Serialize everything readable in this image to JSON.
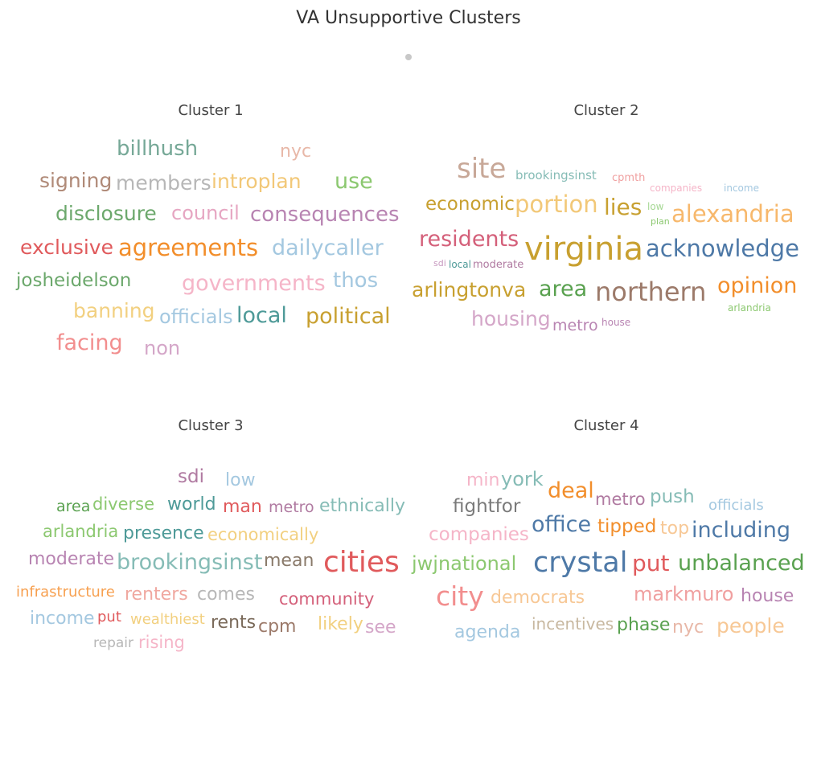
{
  "title": "VA Unsupportive Clusters",
  "chart_data": [
    {
      "type": "wordcloud",
      "title": "Cluster 1",
      "words": [
        {
          "text": "billhush",
          "size": 26,
          "color": "#76a897"
        },
        {
          "text": "nyc",
          "size": 22,
          "color": "#e8b8a8"
        },
        {
          "text": "signing",
          "size": 25,
          "color": "#b08a78"
        },
        {
          "text": "members",
          "size": 25,
          "color": "#b7b7b7"
        },
        {
          "text": "introplan",
          "size": 25,
          "color": "#f2c878"
        },
        {
          "text": "use",
          "size": 27,
          "color": "#8cc870"
        },
        {
          "text": "disclosure",
          "size": 25,
          "color": "#6ca86c"
        },
        {
          "text": "council",
          "size": 24,
          "color": "#e6a6c2"
        },
        {
          "text": "consequences",
          "size": 26,
          "color": "#b884b2"
        },
        {
          "text": "exclusive",
          "size": 25,
          "color": "#e05a5c"
        },
        {
          "text": "agreements",
          "size": 29,
          "color": "#f28e2b"
        },
        {
          "text": "dailycaller",
          "size": 27,
          "color": "#a4c8e0"
        },
        {
          "text": "josheidelson",
          "size": 23,
          "color": "#6ca86c"
        },
        {
          "text": "governments",
          "size": 27,
          "color": "#f5b5c8"
        },
        {
          "text": "thos",
          "size": 26,
          "color": "#a4c8e0"
        },
        {
          "text": "banning",
          "size": 25,
          "color": "#f2d080"
        },
        {
          "text": "officials",
          "size": 24,
          "color": "#a4c8e0"
        },
        {
          "text": "local",
          "size": 27,
          "color": "#4e9a98"
        },
        {
          "text": "political",
          "size": 27,
          "color": "#c8a030"
        },
        {
          "text": "facing",
          "size": 27,
          "color": "#f28e8e"
        },
        {
          "text": "non",
          "size": 24,
          "color": "#d4a6c8"
        }
      ]
    },
    {
      "type": "wordcloud",
      "title": "Cluster 2",
      "words": [
        {
          "text": "site",
          "size": 34,
          "color": "#c8a898"
        },
        {
          "text": "brookingsinst",
          "size": 15,
          "color": "#86bcb6"
        },
        {
          "text": "cpmth",
          "size": 13,
          "color": "#f0a0a0"
        },
        {
          "text": "companies",
          "size": 12,
          "color": "#f5b5c8"
        },
        {
          "text": "income",
          "size": 12,
          "color": "#a4c8e0"
        },
        {
          "text": "economic",
          "size": 23,
          "color": "#c8a030"
        },
        {
          "text": "portion",
          "size": 29,
          "color": "#f2c878"
        },
        {
          "text": "lies",
          "size": 28,
          "color": "#c8a030"
        },
        {
          "text": "low",
          "size": 12,
          "color": "#a6d894"
        },
        {
          "text": "plan",
          "size": 11,
          "color": "#8cc870"
        },
        {
          "text": "alexandria",
          "size": 29,
          "color": "#f7b86c"
        },
        {
          "text": "residents",
          "size": 27,
          "color": "#d4607a"
        },
        {
          "text": "virginia",
          "size": 40,
          "color": "#c8a030"
        },
        {
          "text": "acknowledge",
          "size": 29,
          "color": "#4e79a7"
        },
        {
          "text": "sdi",
          "size": 11,
          "color": "#c89ac0"
        },
        {
          "text": "local",
          "size": 12,
          "color": "#4e9a98"
        },
        {
          "text": "moderate",
          "size": 13,
          "color": "#b07aa1"
        },
        {
          "text": "arlingtonva",
          "size": 25,
          "color": "#c8a030"
        },
        {
          "text": "area",
          "size": 27,
          "color": "#59a14f"
        },
        {
          "text": "northern",
          "size": 32,
          "color": "#9c7a6a"
        },
        {
          "text": "opinion",
          "size": 27,
          "color": "#f28e2b"
        },
        {
          "text": "arlandria",
          "size": 12,
          "color": "#8cc870"
        },
        {
          "text": "housing",
          "size": 25,
          "color": "#d4a6c8"
        },
        {
          "text": "metro",
          "size": 19,
          "color": "#b884b2"
        },
        {
          "text": "house",
          "size": 12,
          "color": "#b884b2"
        }
      ]
    },
    {
      "type": "wordcloud",
      "title": "Cluster 3",
      "words": [
        {
          "text": "sdi",
          "size": 23,
          "color": "#b07aa1"
        },
        {
          "text": "low",
          "size": 22,
          "color": "#a4c8e0"
        },
        {
          "text": "area",
          "size": 19,
          "color": "#59a14f"
        },
        {
          "text": "diverse",
          "size": 21,
          "color": "#8cc870"
        },
        {
          "text": "world",
          "size": 22,
          "color": "#4e9a98"
        },
        {
          "text": "man",
          "size": 22,
          "color": "#e05a5c"
        },
        {
          "text": "metro",
          "size": 19,
          "color": "#b07aa1"
        },
        {
          "text": "ethnically",
          "size": 22,
          "color": "#86bcb6"
        },
        {
          "text": "arlandria",
          "size": 21,
          "color": "#8cc870"
        },
        {
          "text": "presence",
          "size": 22,
          "color": "#4e9a98"
        },
        {
          "text": "economically",
          "size": 21,
          "color": "#f2d080"
        },
        {
          "text": "moderate",
          "size": 22,
          "color": "#b884b2"
        },
        {
          "text": "brookingsinst",
          "size": 27,
          "color": "#86bcb6"
        },
        {
          "text": "mean",
          "size": 22,
          "color": "#8a7a6a"
        },
        {
          "text": "cities",
          "size": 36,
          "color": "#e05a5c"
        },
        {
          "text": "infrastructure",
          "size": 18,
          "color": "#f7a050"
        },
        {
          "text": "renters",
          "size": 22,
          "color": "#f0a8a0"
        },
        {
          "text": "comes",
          "size": 22,
          "color": "#b7b7b7"
        },
        {
          "text": "community",
          "size": 21,
          "color": "#d4607a"
        },
        {
          "text": "income",
          "size": 22,
          "color": "#a4c8e0"
        },
        {
          "text": "put",
          "size": 18,
          "color": "#e05a5c"
        },
        {
          "text": "wealthiest",
          "size": 18,
          "color": "#f2d080"
        },
        {
          "text": "rents",
          "size": 22,
          "color": "#7a6a5a"
        },
        {
          "text": "cpm",
          "size": 22,
          "color": "#9c7a6a"
        },
        {
          "text": "likely",
          "size": 22,
          "color": "#f2d080"
        },
        {
          "text": "see",
          "size": 22,
          "color": "#d4a6c8"
        },
        {
          "text": "repair",
          "size": 17,
          "color": "#b7b7b7"
        },
        {
          "text": "rising",
          "size": 21,
          "color": "#f5b5c8"
        }
      ]
    },
    {
      "type": "wordcloud",
      "title": "Cluster 4",
      "words": [
        {
          "text": "min",
          "size": 22,
          "color": "#f5b5c8"
        },
        {
          "text": "york",
          "size": 24,
          "color": "#86bcb6"
        },
        {
          "text": "deal",
          "size": 27,
          "color": "#f28e2b"
        },
        {
          "text": "metro",
          "size": 21,
          "color": "#b07aa1"
        },
        {
          "text": "push",
          "size": 23,
          "color": "#86bcb6"
        },
        {
          "text": "officials",
          "size": 18,
          "color": "#a4c8e0"
        },
        {
          "text": "fightfor",
          "size": 23,
          "color": "#7a7a7a"
        },
        {
          "text": "office",
          "size": 27,
          "color": "#4e79a7"
        },
        {
          "text": "tipped",
          "size": 23,
          "color": "#f28e2b"
        },
        {
          "text": "top",
          "size": 22,
          "color": "#f7c896"
        },
        {
          "text": "including",
          "size": 27,
          "color": "#4e79a7"
        },
        {
          "text": "companies",
          "size": 23,
          "color": "#f5b5c8"
        },
        {
          "text": "jwjnational",
          "size": 24,
          "color": "#8cc870"
        },
        {
          "text": "crystal",
          "size": 35,
          "color": "#4e79a7"
        },
        {
          "text": "put",
          "size": 28,
          "color": "#e05a5c"
        },
        {
          "text": "unbalanced",
          "size": 27,
          "color": "#59a14f"
        },
        {
          "text": "city",
          "size": 33,
          "color": "#f28e8e"
        },
        {
          "text": "democrats",
          "size": 22,
          "color": "#f7c896"
        },
        {
          "text": "markmuro",
          "size": 24,
          "color": "#f0a0a0"
        },
        {
          "text": "house",
          "size": 22,
          "color": "#b884b2"
        },
        {
          "text": "agenda",
          "size": 22,
          "color": "#a4c8e0"
        },
        {
          "text": "incentives",
          "size": 20,
          "color": "#c8b8a0"
        },
        {
          "text": "phase",
          "size": 22,
          "color": "#59a14f"
        },
        {
          "text": "nyc",
          "size": 22,
          "color": "#e8b8a8"
        },
        {
          "text": "people",
          "size": 25,
          "color": "#f7c896"
        }
      ]
    }
  ]
}
